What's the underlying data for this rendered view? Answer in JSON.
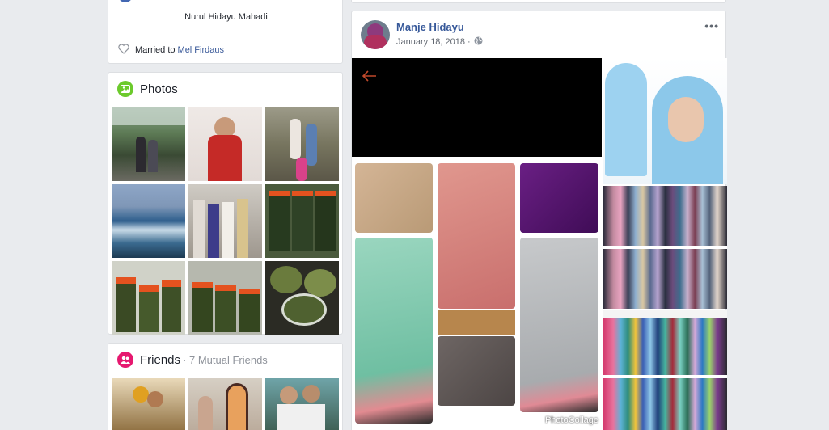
{
  "intro": {
    "related_name": "Nurul Hidayu Mahadi",
    "relationship_prefix": "Married to",
    "relationship_partner": "Mel Firdaus"
  },
  "photos": {
    "title": "Photos",
    "icon": "photos-icon",
    "accent": "#6cca2c"
  },
  "friends": {
    "title": "Friends",
    "subtitle": "· 7 Mutual Friends",
    "icon": "friends-icon",
    "accent": "#e6186f"
  },
  "post": {
    "author": "Manje Hidayu",
    "date": "January 18, 2018",
    "separator": "·",
    "privacy_icon": "globe-icon",
    "options_label": "•••",
    "watermark": "PhotoCollage"
  },
  "colors": {
    "page_bg": "#e9ebee",
    "link": "#365899",
    "arrow": "#c0492b"
  }
}
